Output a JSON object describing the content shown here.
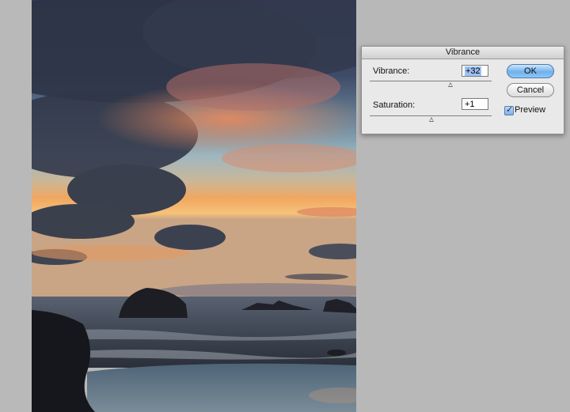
{
  "dialog": {
    "title": "Vibrance",
    "vibrance": {
      "label": "Vibrance:",
      "value": "+32",
      "level": 32,
      "min": -100,
      "max": 100
    },
    "saturation": {
      "label": "Saturation:",
      "value": "+1",
      "level": 1,
      "min": -100,
      "max": 100
    },
    "ok_label": "OK",
    "cancel_label": "Cancel",
    "preview": {
      "label": "Preview",
      "checked": true,
      "check_glyph": "✓"
    }
  },
  "icons": {
    "slider_thumb": "triangle-up-icon",
    "checkmark": "checkmark-icon"
  },
  "colors": {
    "accent": "#6fb1ec",
    "dialog_bg": "#e9e9e9",
    "canvas_bg": "#b8b8b8"
  }
}
